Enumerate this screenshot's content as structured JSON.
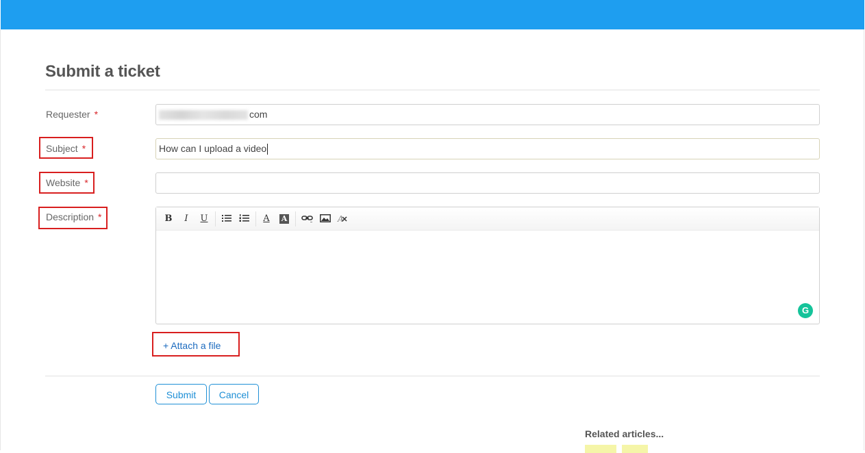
{
  "form": {
    "title": "Submit a ticket",
    "requester": {
      "label": "Requester",
      "required_mark": "*",
      "value_suffix": "com"
    },
    "subject": {
      "label": "Subject",
      "required_mark": "*",
      "value": "How can I upload a video"
    },
    "website": {
      "label": "Website",
      "required_mark": "*",
      "value": ""
    },
    "description": {
      "label": "Description",
      "required_mark": "*",
      "toolbar": {
        "bold": "B",
        "italic": "I",
        "underline": "U",
        "bulleted_list": "bulleted-list-icon",
        "numbered_list": "numbered-list-icon",
        "font_color": "A",
        "background_color": "A",
        "link": "link-icon",
        "image": "image-icon",
        "clear_format": "clear-format-icon"
      }
    },
    "attach_label": "+ Attach a file",
    "submit_label": "Submit",
    "cancel_label": "Cancel"
  },
  "related": {
    "title": "Related articles..."
  },
  "colors": {
    "topbar": "#1e9ef0",
    "highlight": "#d81e1e",
    "accent": "#1e8fd6",
    "required": "#d9262a"
  }
}
